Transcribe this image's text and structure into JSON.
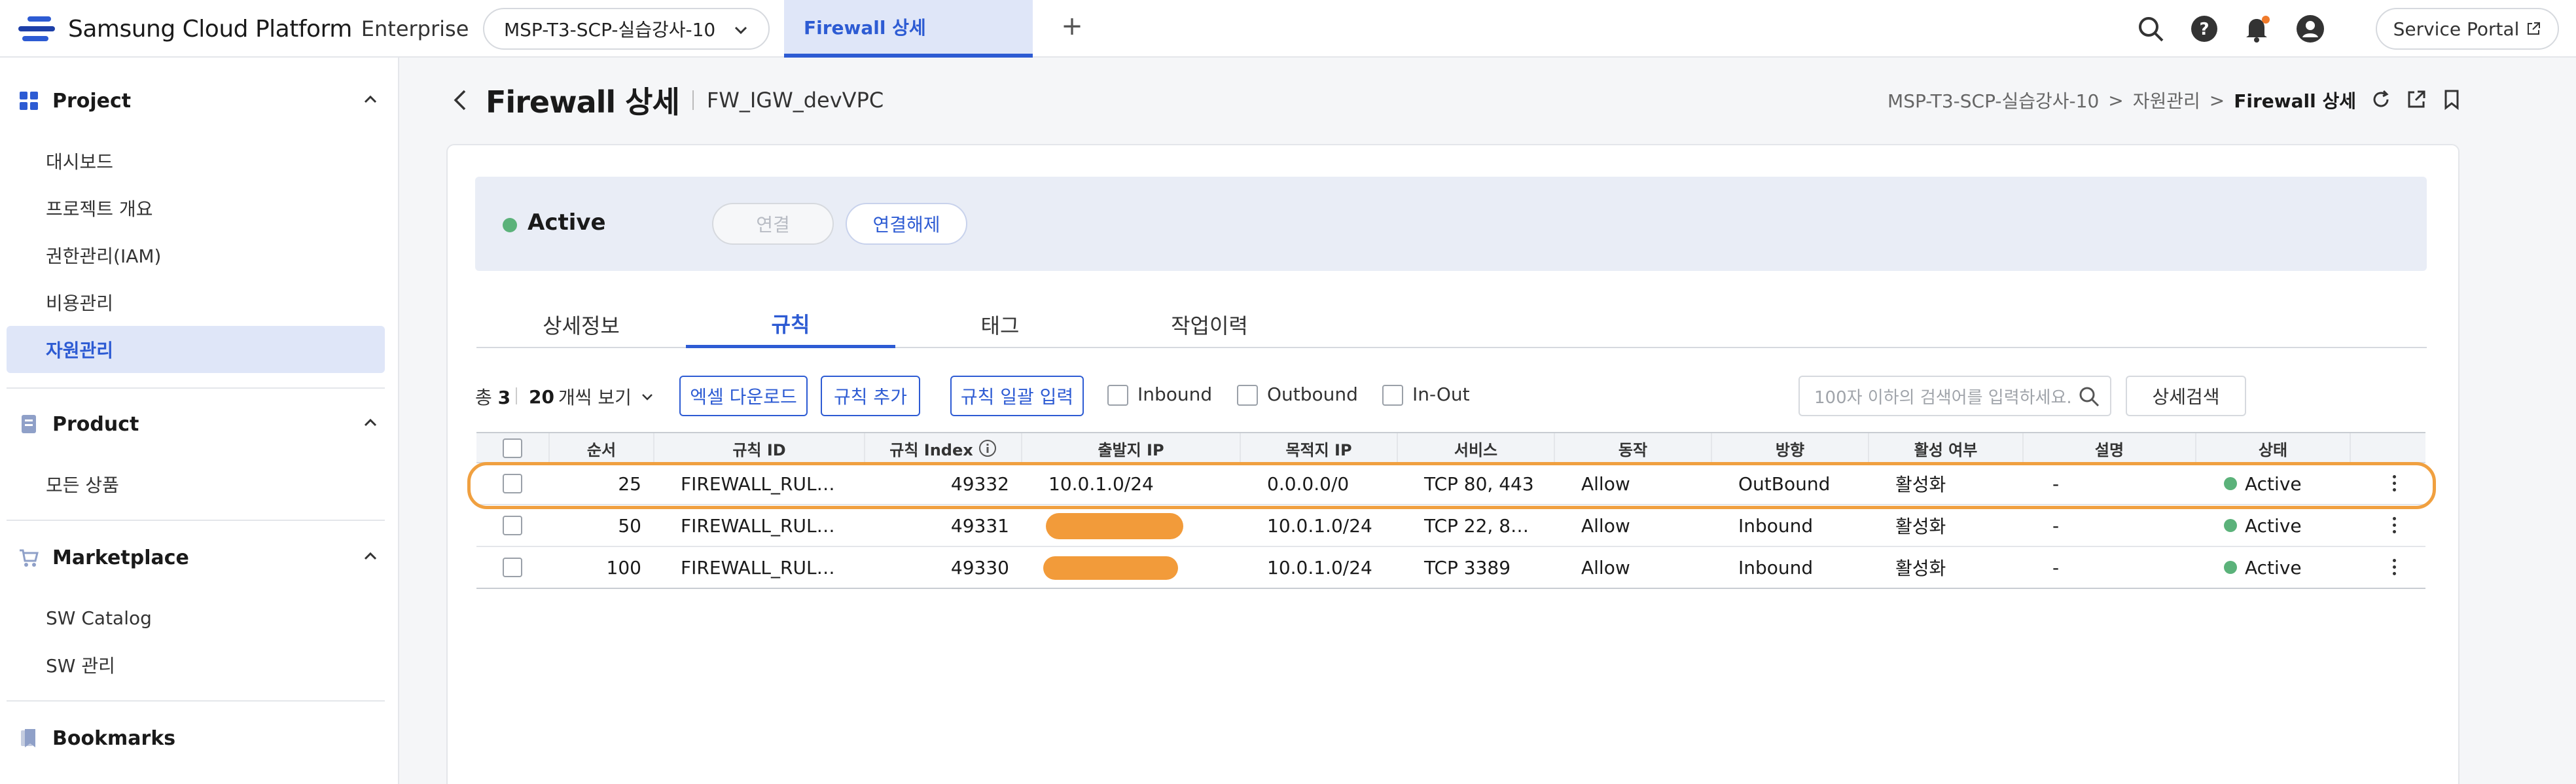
{
  "topbar": {
    "brand": "Samsung Cloud Platform",
    "edition": "Enterprise",
    "project": "MSP-T3-SCP-실습강사-10",
    "active_tab": "Firewall 상세",
    "service_portal": "Service Portal"
  },
  "sidebar": {
    "project_label": "Project",
    "project_items": [
      "대시보드",
      "프로젝트 개요",
      "권한관리(IAM)",
      "비용관리",
      "자원관리"
    ],
    "product_label": "Product",
    "product_items": [
      "모든 상품"
    ],
    "marketplace_label": "Marketplace",
    "marketplace_items": [
      "SW Catalog",
      "SW 관리"
    ],
    "bookmarks_label": "Bookmarks"
  },
  "header": {
    "title": "Firewall 상세",
    "subtitle": "FW_IGW_devVPC",
    "breadcrumb": [
      "MSP-T3-SCP-실습강사-10",
      "자원관리",
      "Firewall 상세"
    ]
  },
  "status": {
    "label": "Active",
    "connect": "연결",
    "disconnect": "연결해제",
    "color": "#5bb27a"
  },
  "tabs": [
    "상세정보",
    "규칙",
    "태그",
    "작업이력"
  ],
  "toolbar": {
    "total_prefix": "총",
    "total": "3",
    "per_page": "20",
    "per_page_suffix": "개씩 보기",
    "excel": "엑셀 다운로드",
    "add_rule": "규칙 추가",
    "bulk_rule": "규칙 일괄 입력",
    "filters": [
      "Inbound",
      "Outbound",
      "In-Out"
    ],
    "search_placeholder": "100자 이하의 검색어를 입력하세요.",
    "detail_search": "상세검색"
  },
  "table": {
    "headers": [
      "순서",
      "규칙 ID",
      "규칙 Index",
      "출발지 IP",
      "목적지 IP",
      "서비스",
      "동작",
      "방향",
      "활성 여부",
      "설명",
      "상태"
    ],
    "rows": [
      {
        "order": "25",
        "rule_id": "FIREWALL_RUL…",
        "index": "49332",
        "src": "10.0.1.0/24",
        "dst": "0.0.0.0/0",
        "service": "TCP 80, 443",
        "action": "Allow",
        "direction": "OutBound",
        "enabled": "활성화",
        "desc": "-",
        "state": "Active"
      },
      {
        "order": "50",
        "rule_id": "FIREWALL_RUL…",
        "index": "49331",
        "src": "",
        "dst": "10.0.1.0/24",
        "service": "TCP 22, 8…",
        "action": "Allow",
        "direction": "Inbound",
        "enabled": "활성화",
        "desc": "-",
        "state": "Active"
      },
      {
        "order": "100",
        "rule_id": "FIREWALL_RUL…",
        "index": "49330",
        "src": "",
        "dst": "10.0.1.0/24",
        "service": "TCP 3389",
        "action": "Allow",
        "direction": "Inbound",
        "enabled": "활성화",
        "desc": "-",
        "state": "Active"
      }
    ]
  },
  "colors": {
    "accent": "#2d5bd3",
    "highlight": "#f0a040"
  }
}
